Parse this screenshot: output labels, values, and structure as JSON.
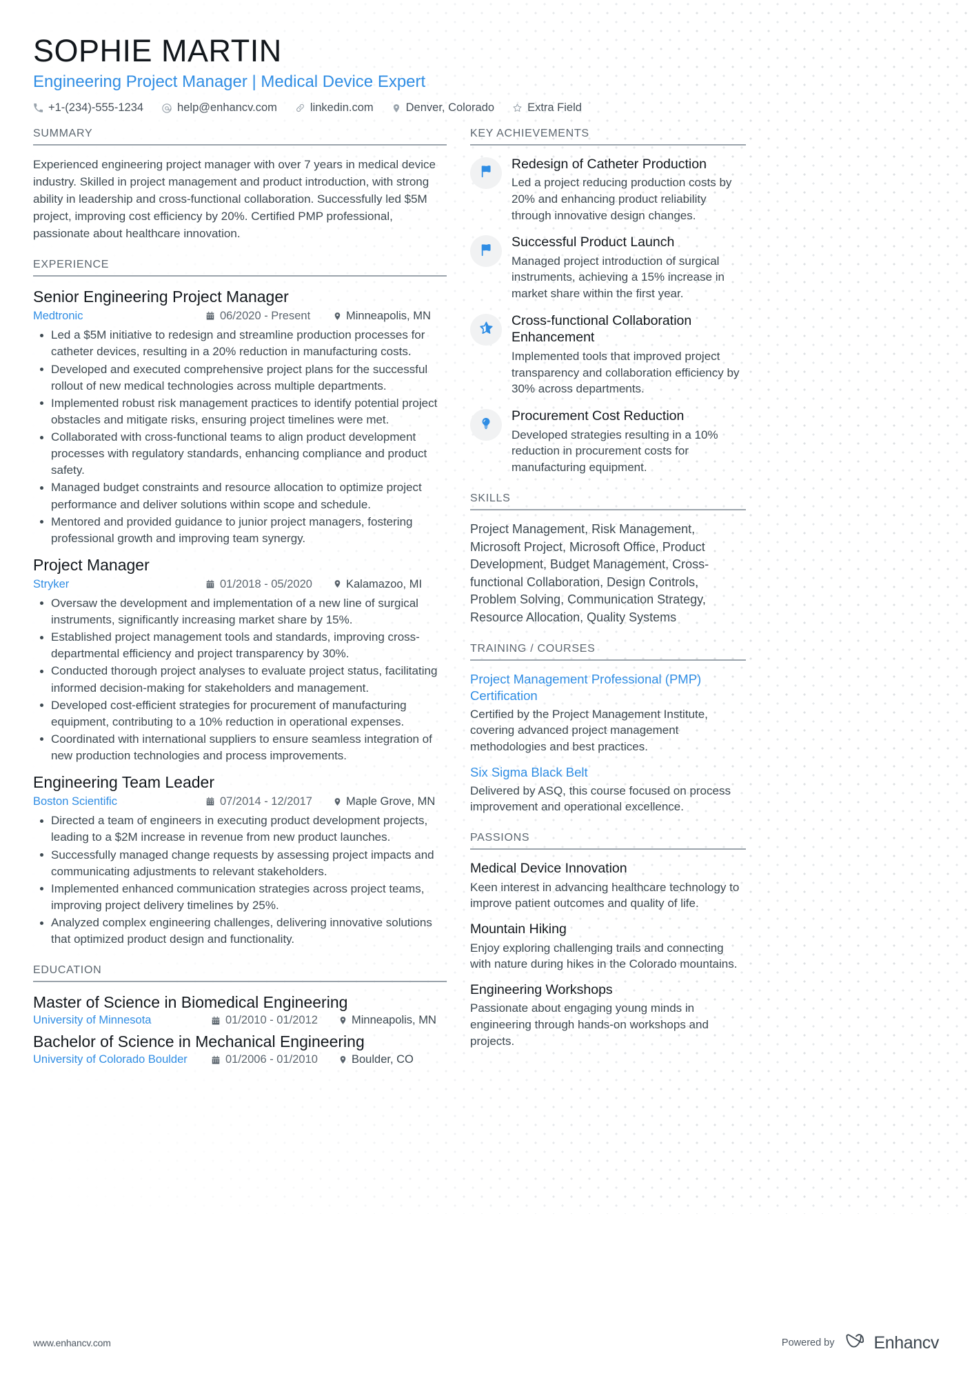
{
  "colors": {
    "accent": "#2f8de4",
    "heading": "#12171c",
    "body": "#3c4850",
    "muted": "#5c666f",
    "rule": "#9aa3ab",
    "badge_bg": "#f1f2f3"
  },
  "header": {
    "name": "SOPHIE MARTIN",
    "headline": "Engineering Project Manager | Medical Device Expert",
    "contacts": [
      {
        "icon": "phone-icon",
        "text": "+1-(234)-555-1234"
      },
      {
        "icon": "email-icon",
        "text": "help@enhancv.com"
      },
      {
        "icon": "link-icon",
        "text": "linkedin.com"
      },
      {
        "icon": "location-pin-icon",
        "text": "Denver, Colorado"
      },
      {
        "icon": "star-outline-icon",
        "text": "Extra Field"
      }
    ]
  },
  "left": {
    "summary": {
      "heading": "SUMMARY",
      "text": "Experienced engineering project manager with over 7 years in medical device industry. Skilled in project management and product introduction, with strong ability in leadership and cross-functional collaboration. Successfully led $5M project, improving cost efficiency by 20%. Certified PMP professional, passionate about healthcare innovation."
    },
    "experience": {
      "heading": "EXPERIENCE",
      "jobs": [
        {
          "title": "Senior Engineering Project Manager",
          "company": "Medtronic",
          "dates": "06/2020 - Present",
          "location": "Minneapolis, MN",
          "bullets": [
            "Led a $5M initiative to redesign and streamline production processes for catheter devices, resulting in a 20% reduction in manufacturing costs.",
            "Developed and executed comprehensive project plans for the successful rollout of new medical technologies across multiple departments.",
            "Implemented robust risk management practices to identify potential project obstacles and mitigate risks, ensuring project timelines were met.",
            "Collaborated with cross-functional teams to align product development processes with regulatory standards, enhancing compliance and product safety.",
            "Managed budget constraints and resource allocation to optimize project performance and deliver solutions within scope and schedule.",
            "Mentored and provided guidance to junior project managers, fostering professional growth and improving team synergy."
          ]
        },
        {
          "title": "Project Manager",
          "company": "Stryker",
          "dates": "01/2018 - 05/2020",
          "location": "Kalamazoo, MI",
          "bullets": [
            "Oversaw the development and implementation of a new line of surgical instruments, significantly increasing market share by 15%.",
            "Established project management tools and standards, improving cross-departmental efficiency and project transparency by 30%.",
            "Conducted thorough project analyses to evaluate project status, facilitating informed decision-making for stakeholders and management.",
            "Developed cost-efficient strategies for procurement of manufacturing equipment, contributing to a 10% reduction in operational expenses.",
            "Coordinated with international suppliers to ensure seamless integration of new production technologies and process improvements."
          ]
        },
        {
          "title": "Engineering Team Leader",
          "company": "Boston Scientific",
          "dates": "07/2014 - 12/2017",
          "location": "Maple Grove, MN",
          "bullets": [
            "Directed a team of engineers in executing product development projects, leading to a $2M increase in revenue from new product launches.",
            "Successfully managed change requests by assessing project impacts and communicating adjustments to relevant stakeholders.",
            "Implemented enhanced communication strategies across project teams, improving project delivery timelines by 25%.",
            "Analyzed complex engineering challenges, delivering innovative solutions that optimized product design and functionality."
          ]
        }
      ]
    },
    "education": {
      "heading": "EDUCATION",
      "entries": [
        {
          "degree": "Master of Science in Biomedical Engineering",
          "school": "University of Minnesota",
          "dates": "01/2010 - 01/2012",
          "location": "Minneapolis, MN"
        },
        {
          "degree": "Bachelor of Science in Mechanical Engineering",
          "school": "University of Colorado Boulder",
          "dates": "01/2006 - 01/2010",
          "location": "Boulder, CO"
        }
      ]
    }
  },
  "right": {
    "achievements": {
      "heading": "KEY ACHIEVEMENTS",
      "items": [
        {
          "icon": "flag-icon",
          "title": "Redesign of Catheter Production",
          "desc": "Led a project reducing production costs by 20% and enhancing product reliability through innovative design changes."
        },
        {
          "icon": "flag-icon",
          "title": "Successful Product Launch",
          "desc": "Managed project introduction of surgical instruments, achieving a 15% increase in market share within the first year."
        },
        {
          "icon": "star-icon",
          "title": "Cross-functional Collaboration Enhancement",
          "desc": "Implemented tools that improved project transparency and collaboration efficiency by 30% across departments."
        },
        {
          "icon": "lightbulb-icon",
          "title": "Procurement Cost Reduction",
          "desc": "Developed strategies resulting in a 10% reduction in procurement costs for manufacturing equipment."
        }
      ]
    },
    "skills": {
      "heading": "SKILLS",
      "text": "Project Management, Risk Management, Microsoft Project, Microsoft Office, Product Development, Budget Management, Cross-functional Collaboration, Design Controls, Problem Solving, Communication Strategy, Resource Allocation, Quality Systems"
    },
    "training": {
      "heading": "TRAINING / COURSES",
      "courses": [
        {
          "title": "Project Management Professional (PMP) Certification",
          "desc": "Certified by the Project Management Institute, covering advanced project management methodologies and best practices."
        },
        {
          "title": "Six Sigma Black Belt",
          "desc": "Delivered by ASQ, this course focused on process improvement and operational excellence."
        }
      ]
    },
    "passions": {
      "heading": "PASSIONS",
      "items": [
        {
          "title": "Medical Device Innovation",
          "desc": "Keen interest in advancing healthcare technology to improve patient outcomes and quality of life."
        },
        {
          "title": "Mountain Hiking",
          "desc": "Enjoy exploring challenging trails and connecting with nature during hikes in the Colorado mountains."
        },
        {
          "title": "Engineering Workshops",
          "desc": "Passionate about engaging young minds in engineering through hands-on workshops and projects."
        }
      ]
    }
  },
  "footer": {
    "url": "www.enhancv.com",
    "powered_by": "Powered by",
    "brand": "Enhancv"
  }
}
